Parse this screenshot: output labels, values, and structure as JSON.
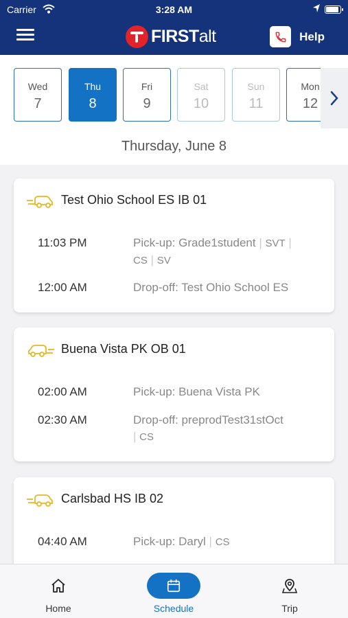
{
  "status": {
    "carrier": "Carrier",
    "time": "3:28 AM"
  },
  "header": {
    "logo_text": "FIRST",
    "logo_suffix": "alt",
    "help_label": "Help"
  },
  "dates": [
    {
      "day": "Wed",
      "date": "7",
      "state": "normal"
    },
    {
      "day": "Thu",
      "date": "8",
      "state": "selected"
    },
    {
      "day": "Fri",
      "date": "9",
      "state": "normal"
    },
    {
      "day": "Sat",
      "date": "10",
      "state": "disabled"
    },
    {
      "day": "Sun",
      "date": "11",
      "state": "disabled"
    },
    {
      "day": "Mon",
      "date": "12",
      "state": "normal"
    }
  ],
  "selected_date_label": "Thursday, June 8",
  "trips": [
    {
      "name": "Test Ohio School ES IB 01",
      "stops": [
        {
          "time": "11:03 PM",
          "desc": "Pick-up: Grade1student",
          "tags": [
            "SVT",
            "CS",
            "SV"
          ]
        },
        {
          "time": "12:00 AM",
          "desc": "Drop-off: Test Ohio School ES",
          "tags": []
        }
      ]
    },
    {
      "name": "Buena Vista PK OB 01",
      "stops": [
        {
          "time": "02:00 AM",
          "desc": "Pick-up: Buena Vista PK",
          "tags": []
        },
        {
          "time": "02:30 AM",
          "desc": "Drop-off: preprodTest31stOct",
          "tags": [
            "CS"
          ]
        }
      ]
    },
    {
      "name": "Carlsbad HS IB 02",
      "stops": [
        {
          "time": "04:40 AM",
          "desc": "Pick-up: Daryl",
          "tags": [
            "CS"
          ]
        }
      ]
    }
  ],
  "nav": {
    "home_label": "Home",
    "schedule_label": "Schedule",
    "trip_label": "Trip"
  },
  "colors": {
    "header_bg": "#14337a",
    "accent": "#1372c4",
    "logo_red": "#e2232a",
    "bus_yellow": "#e8b820"
  }
}
